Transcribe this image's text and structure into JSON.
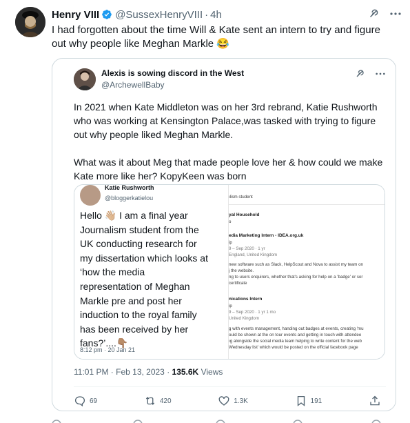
{
  "author": {
    "name": "Henry VIII",
    "handle": "@SussexHenryVIII",
    "separator": "·",
    "time": "4h",
    "text": "I had forgotten about the time Will & Kate sent an intern to try and figure\nout why people like Meghan Markle 😂"
  },
  "quoted": {
    "name": "Alexis is sowing discord in the West",
    "handle": "@ArchewellBaby",
    "text": "In 2021 when Kate Middleton was on her 3rd rebrand, Katie Rushworth\nwho was working at Kensington Palace,was tasked with trying to figure\nout why people liked Meghan Markle.\n\nWhat was it about Meg that made people love her & how could we make\nKate more like her? KopyKeen was born",
    "media": {
      "left": {
        "name": "Katie Rushworth",
        "handle": "@bloggerkatielou",
        "body": "Hello 👋🏼 I am a final year\nJournalism student from the\nUK conducting research for\nmy dissertation which looks at\n‘how the media\nrepresentation of Meghan\nMarkle pre and post her\ninduction to the royal family\nhas been received by her\nfans?’....👇🏽",
        "date": "8:12 pm · 20 Jan 21"
      },
      "right": {
        "lines": [
          "ılism student",
          "yal Household",
          "o",
          "edia Marketing Intern - IDEA.org.uk",
          "ip",
          "9 – Sep 2020 · 1 yr",
          "England, United Kingdom",
          "new software such as Slack, HelpScout and Nova to assist my team on",
          "j the website.",
          "ng to users enquirers, whether that's asking for help on a 'badge' or sor",
          "certificate",
          "nications Intern",
          "ip",
          "9 – Sep 2020 · 1 yr 1 mo",
          "United Kingdom",
          "g with events management, handing out badges at events, creating 'mu",
          "ould be shown at the on tour events and getting in touch with attendee",
          "ıg alongside the social media team helping to write content for the web",
          "Wednesday list' which would be posted on the official facebook page"
        ]
      }
    },
    "timestamp": "11:01 PM · Feb 13, 2023 · ",
    "views_count": "135.6K",
    "views_label": " Views",
    "stats": {
      "replies": "69",
      "retweets": "420",
      "likes": "1.3K",
      "bookmarks": "191"
    }
  },
  "icons": {
    "verified": "verified-badge-icon",
    "grok": "grok-icon",
    "more": "more-icon",
    "reply": "reply-icon",
    "retweet": "retweet-icon",
    "like": "like-icon",
    "bookmark": "bookmark-icon",
    "share": "share-icon"
  },
  "colors": {
    "verified": "#1d9bf0",
    "text": "#0f1419",
    "secondary": "#536471",
    "border": "#cfd9de"
  }
}
